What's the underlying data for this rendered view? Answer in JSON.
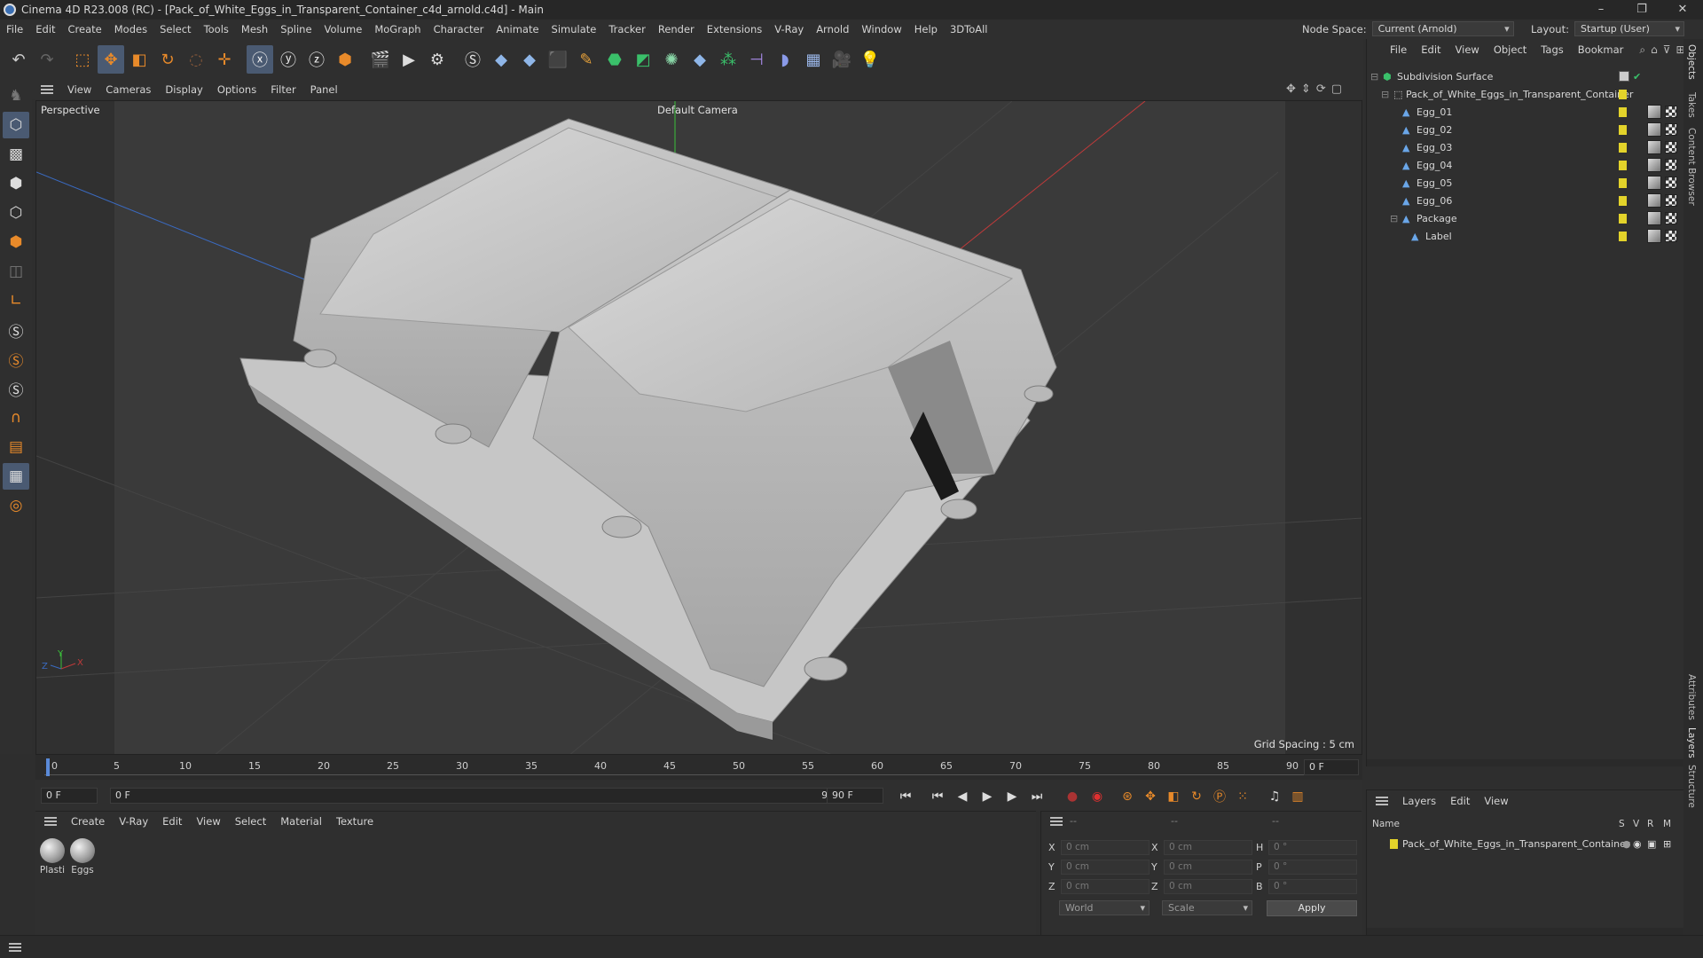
{
  "window": {
    "title": "Cinema 4D R23.008 (RC) - [Pack_of_White_Eggs_in_Transparent_Container_c4d_arnold.c4d] - Main",
    "controls": [
      "–",
      "❐",
      "✕"
    ]
  },
  "menubar": {
    "items": [
      "File",
      "Edit",
      "Create",
      "Modes",
      "Select",
      "Tools",
      "Mesh",
      "Spline",
      "Volume",
      "MoGraph",
      "Character",
      "Animate",
      "Simulate",
      "Tracker",
      "Render",
      "Extensions",
      "V-Ray",
      "Arnold",
      "Window",
      "Help",
      "3DToAll"
    ],
    "node_space_label": "Node Space:",
    "node_space_value": "Current (Arnold)",
    "layout_label": "Layout:",
    "layout_value": "Startup (User)"
  },
  "viewport_menu": {
    "items": [
      "View",
      "Cameras",
      "Display",
      "Options",
      "Filter",
      "Panel"
    ]
  },
  "viewport": {
    "label": "Perspective",
    "camera": "Default Camera",
    "grid_spacing": "Grid Spacing : 5 cm",
    "axis_labels": {
      "x": "X",
      "y": "Y",
      "z": "Z"
    }
  },
  "timeline": {
    "ticks": [
      "0",
      "5",
      "10",
      "15",
      "20",
      "25",
      "30",
      "35",
      "40",
      "45",
      "50",
      "55",
      "60",
      "65",
      "70",
      "75",
      "80",
      "85",
      "90"
    ],
    "current_frame": "0 F",
    "start_frame": "0 F",
    "range_start": "0 F",
    "range_end": "90 F",
    "end_frame": "90 F"
  },
  "material_menu": {
    "items": [
      "Create",
      "V-Ray",
      "Edit",
      "View",
      "Select",
      "Material",
      "Texture"
    ]
  },
  "materials": [
    {
      "name": "Plasti"
    },
    {
      "name": "Eggs"
    }
  ],
  "coords": {
    "header": [
      "--",
      "--",
      "--"
    ],
    "rows": [
      {
        "axis": "X",
        "pos": "0 cm",
        "axis2": "X",
        "size": "0 cm",
        "axis3": "H",
        "rot": "0 °"
      },
      {
        "axis": "Y",
        "pos": "0 cm",
        "axis2": "Y",
        "size": "0 cm",
        "axis3": "P",
        "rot": "0 °"
      },
      {
        "axis": "Z",
        "pos": "0 cm",
        "axis2": "Z",
        "size": "0 cm",
        "axis3": "B",
        "rot": "0 °"
      }
    ],
    "space": "World",
    "mode": "Scale",
    "apply_label": "Apply"
  },
  "object_manager": {
    "menu": [
      "File",
      "Edit",
      "View",
      "Object",
      "Tags",
      "Bookmar"
    ],
    "objects": [
      {
        "name": "Subdivision Surface",
        "level": 0
      },
      {
        "name": "Pack_of_White_Eggs_in_Transparent_Container",
        "level": 1
      },
      {
        "name": "Egg_01",
        "level": 2
      },
      {
        "name": "Egg_02",
        "level": 2
      },
      {
        "name": "Egg_03",
        "level": 2
      },
      {
        "name": "Egg_04",
        "level": 2
      },
      {
        "name": "Egg_05",
        "level": 2
      },
      {
        "name": "Egg_06",
        "level": 2
      },
      {
        "name": "Package",
        "level": 2
      },
      {
        "name": "Label",
        "level": 3
      }
    ]
  },
  "layer_manager": {
    "menu": [
      "Layers",
      "Edit",
      "View"
    ],
    "columns": [
      "Name",
      "S",
      "V",
      "R",
      "M"
    ],
    "layers": [
      {
        "name": "Pack_of_White_Eggs_in_Transparent_Container",
        "color": "#e3d32a"
      }
    ]
  },
  "right_tabs": [
    "Objects",
    "Takes",
    "Content Browser",
    "Attributes",
    "Layers",
    "Structure"
  ],
  "colors": {
    "accent": "#4a5a72",
    "layer_yellow": "#e3d32a",
    "axis_x": "#c03a3a",
    "axis_y": "#3ac03a",
    "axis_z": "#3a6ac0"
  }
}
